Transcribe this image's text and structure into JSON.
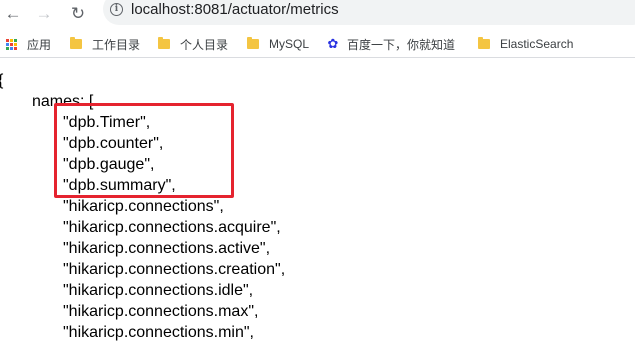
{
  "browser": {
    "url": "localhost:8081/actuator/metrics",
    "icons": {
      "back": "back-arrow-icon",
      "forward": "forward-arrow-icon",
      "reload": "reload-icon",
      "info": "info-icon"
    }
  },
  "bookmarks": [
    {
      "label": "应用",
      "icon": "apps-icon"
    },
    {
      "label": "工作目录",
      "icon": "folder-icon"
    },
    {
      "label": "个人目录",
      "icon": "folder-icon"
    },
    {
      "label": "MySQL",
      "icon": "folder-icon"
    },
    {
      "label": "百度一下，你就知道",
      "icon": "baidu-paw-icon"
    },
    {
      "label": "ElasticSearch",
      "icon": "folder-icon"
    }
  ],
  "json_view": {
    "open_brace": "{",
    "key_line": "names: [",
    "items": [
      "\"dpb.Timer\",",
      "\"dpb.counter\",",
      "\"dpb.gauge\",",
      "\"dpb.summary\",",
      "\"hikaricp.connections\",",
      "\"hikaricp.connections.acquire\",",
      "\"hikaricp.connections.active\",",
      "\"hikaricp.connections.creation\",",
      "\"hikaricp.connections.idle\",",
      "\"hikaricp.connections.max\",",
      "\"hikaricp.connections.min\","
    ]
  },
  "colors": {
    "highlight": "#e5232f",
    "folder": "#f4c542"
  }
}
